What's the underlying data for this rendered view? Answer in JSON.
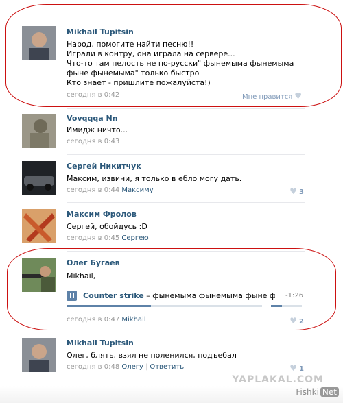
{
  "posts": [
    {
      "author": "Mikhail Tupitsin",
      "lines": [
        "Народ, помогите найти песню!!",
        "Играли в контру, она играла на сервере...",
        "Что-то там пелость не по-русски\" фынемыма фынемыма",
        "фыне фынемыма\" только быстро",
        "Кто знает - пришлите пожалуйста!)"
      ],
      "time": "сегодня в 0:42",
      "like_label": "Мне нравится"
    },
    {
      "author": "Vovqqqa Nn",
      "lines": [
        "Имидж ничто..."
      ],
      "time": "сегодня в 0:43"
    },
    {
      "author": "Сергей Никитчук",
      "lines": [
        "Максим, извини, я только в ебло могу дать."
      ],
      "time": "сегодня в 0:44",
      "reply_to": "Максиму",
      "likes": "3"
    },
    {
      "author": "Максим Фролов",
      "lines": [
        "Сергей, обойдусь :D"
      ],
      "time": "сегодня в 0:45",
      "reply_to": "Сергею"
    },
    {
      "author": "Олег Бугаев",
      "lines": [
        "Mikhail,"
      ],
      "audio": {
        "artist": "Counter strike",
        "title": " – фынемыма фынемыма фыне ф...",
        "time": "-1:26",
        "progress": 0.43,
        "volume": 0.35
      },
      "time": "сегодня в 0:47",
      "reply_to": "Mikhail",
      "likes": "2"
    },
    {
      "author": "Mikhail Tupitsin",
      "lines": [
        "Олег, блять, взял не поленился, подъебал"
      ],
      "time": "сегодня в 0:48",
      "reply_to": "Олегу",
      "reply_action": "Ответить",
      "likes": "1"
    }
  ],
  "watermarks": {
    "yaplakal": "YAPLAKAL.COM",
    "fishki": "Fishki",
    "net": "Net"
  },
  "colors": {
    "link": "#2b587a",
    "meta": "#999999",
    "annotation": "#cc1111",
    "likes": "#7f99b8"
  }
}
